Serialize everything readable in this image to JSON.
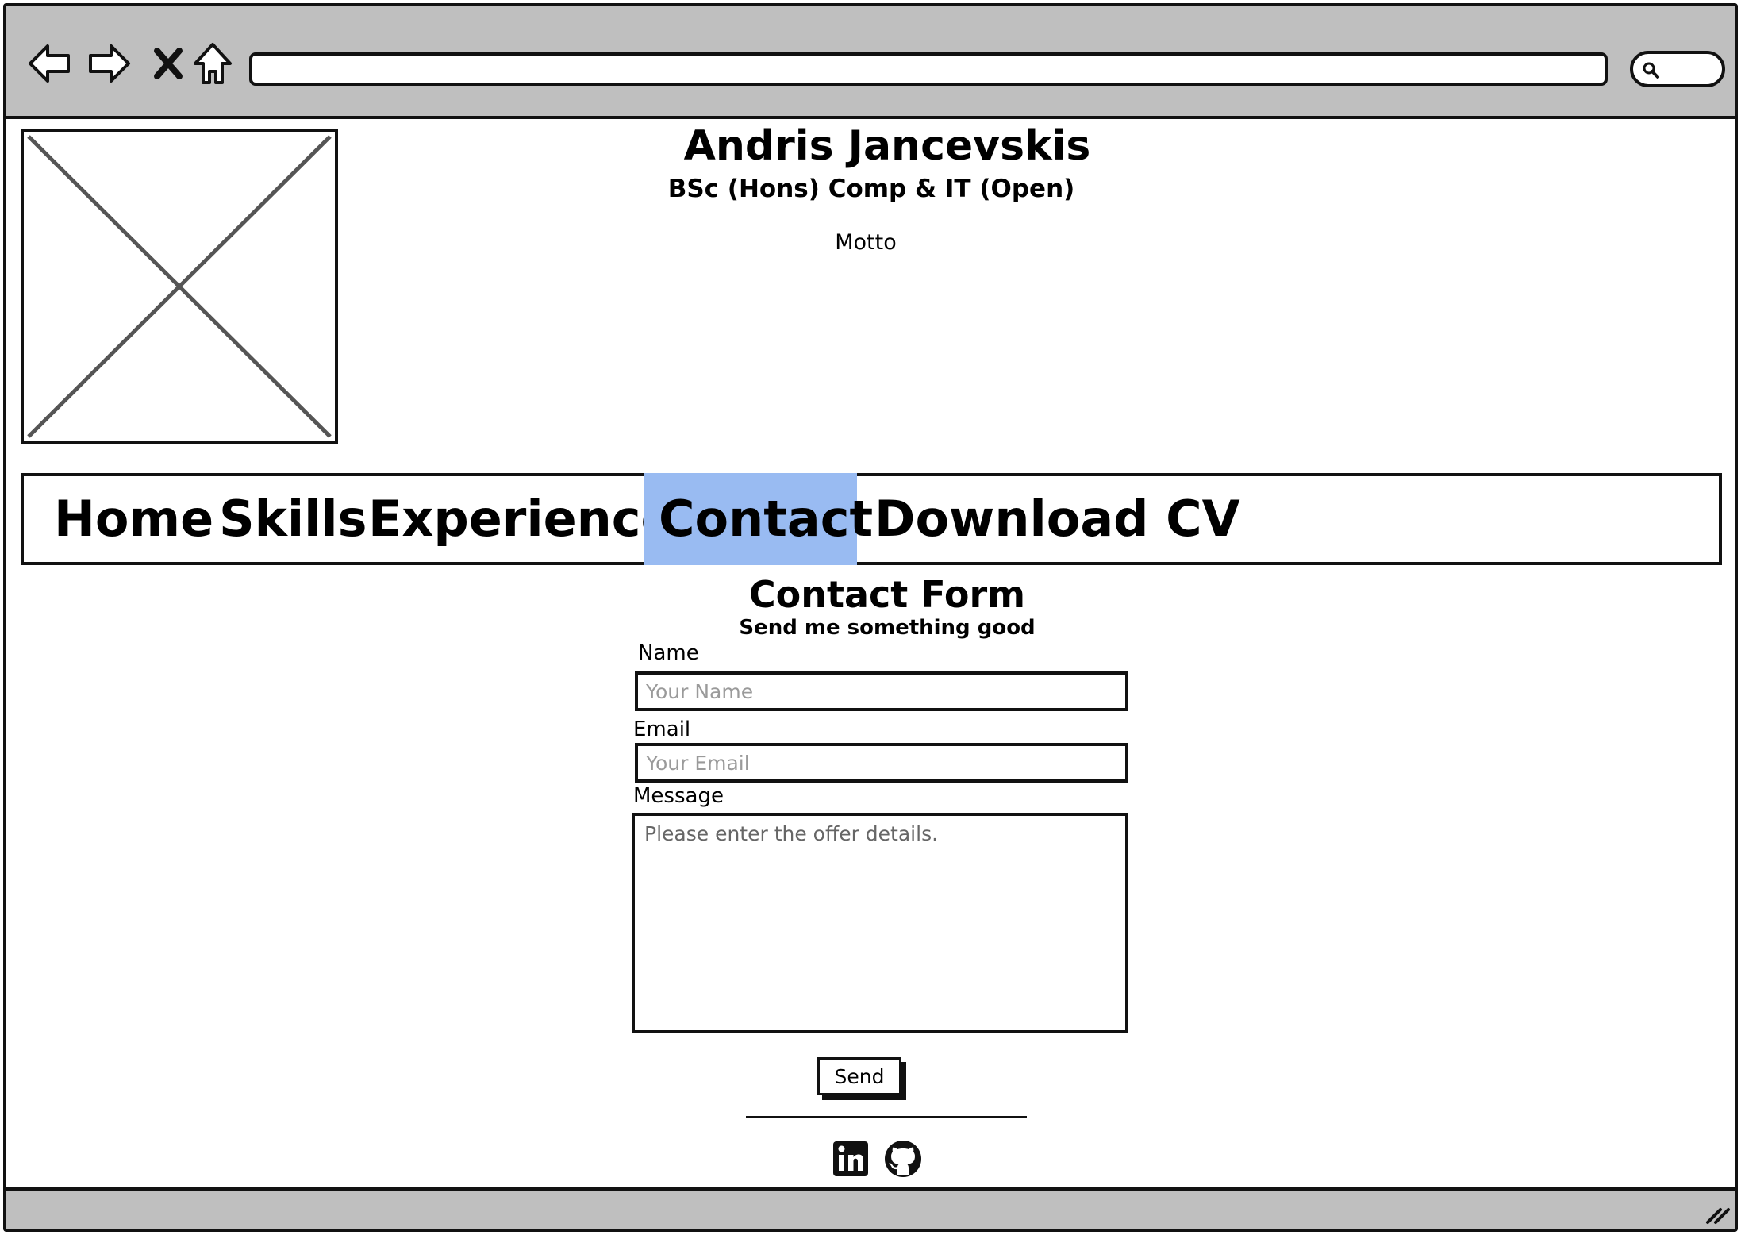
{
  "header": {
    "name": "Andris Jancevskis",
    "degree": "BSc (Hons) Comp & IT (Open)",
    "motto": "Motto"
  },
  "nav": {
    "items": [
      {
        "label": "Home",
        "active": false
      },
      {
        "label": "Skills",
        "active": false
      },
      {
        "label": "Experience",
        "active": false
      },
      {
        "label": "Contact",
        "active": true
      },
      {
        "label": "Download CV",
        "active": false
      }
    ],
    "active_color": "#99bbf2"
  },
  "form": {
    "title": "Contact Form",
    "subtitle": "Send me something good",
    "name_label": "Name",
    "name_placeholder": "Your Name",
    "email_label": "Email",
    "email_placeholder": "Your Email",
    "message_label": "Message",
    "message_placeholder": "Please enter the offer details.",
    "send_label": "Send"
  },
  "social": {
    "icons": [
      "linkedin-icon",
      "github-icon"
    ]
  },
  "browser": {
    "chrome_color": "#bfbfbf",
    "icons": [
      "back-arrow-icon",
      "forward-arrow-icon",
      "close-icon",
      "home-icon",
      "search-icon",
      "resize-grip-icon"
    ]
  }
}
